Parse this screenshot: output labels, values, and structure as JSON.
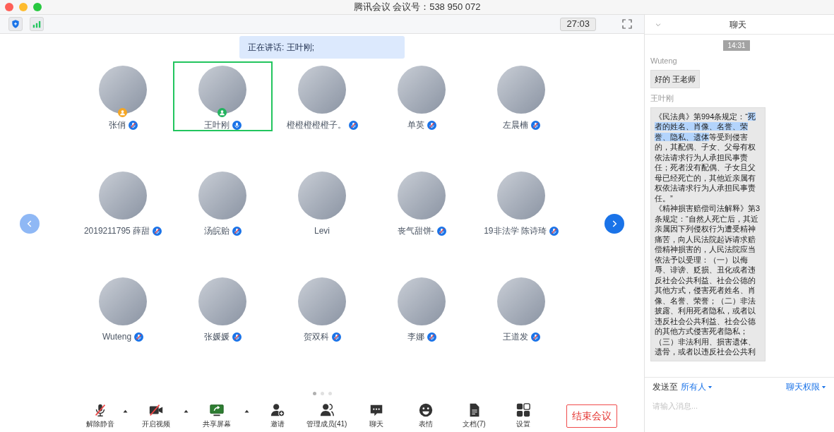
{
  "window": {
    "title": "腾讯会议 会议号：538 950 072"
  },
  "toolbar": {
    "timer": "27:03"
  },
  "speaking_banner": "正在讲话: 王叶刚;",
  "participants": [
    {
      "name": "张俏",
      "muted": true,
      "color": "#f5a623",
      "selected": false
    },
    {
      "name": "王叶刚",
      "muted": false,
      "color": "#22b35e",
      "selected": true
    },
    {
      "name": "橙橙橙橙橙子。",
      "muted": true,
      "selected": false
    },
    {
      "name": "单英",
      "muted": true,
      "selected": false
    },
    {
      "name": "左晨楠",
      "muted": true,
      "selected": false
    },
    {
      "name": "2019211795 薛甜",
      "muted": true,
      "selected": false
    },
    {
      "name": "汤皖贻",
      "muted": true,
      "selected": false
    },
    {
      "name": "Levi",
      "selected": false
    },
    {
      "name": "丧气甜饼-",
      "muted": true,
      "selected": false
    },
    {
      "name": "19非法学 陈诗琦",
      "muted": true,
      "selected": false
    },
    {
      "name": "Wuteng",
      "muted": true,
      "selected": false
    },
    {
      "name": "张媛媛",
      "muted": true,
      "selected": false
    },
    {
      "name": "贺双科",
      "muted": true,
      "selected": false
    },
    {
      "name": "李娜",
      "muted": true,
      "selected": false
    },
    {
      "name": "王道发",
      "muted": true,
      "selected": false
    }
  ],
  "pager": [
    {
      "selected": true
    },
    {
      "selected": false
    },
    {
      "selected": false
    }
  ],
  "bottom_bar": [
    {
      "kind": "mic",
      "label": "解除静音",
      "caret": true
    },
    {
      "kind": "video",
      "label": "开启视频",
      "caret": true
    },
    {
      "kind": "share",
      "label": "共享屏幕",
      "caret": true
    },
    {
      "kind": "invite",
      "label": "邀请",
      "caret": false
    },
    {
      "kind": "members",
      "label": "管理成员(41)",
      "caret": false
    },
    {
      "kind": "chat",
      "label": "聊天",
      "caret": false
    },
    {
      "kind": "emoji",
      "label": "表情",
      "caret": false
    },
    {
      "kind": "docs",
      "label": "文档(7)",
      "caret": false
    },
    {
      "kind": "settings",
      "label": "设置",
      "caret": false
    }
  ],
  "end_button": "结束会议",
  "chat": {
    "title": "聊天",
    "timestamp": "14:31",
    "messages": [
      {
        "sender": "Wuteng",
        "paragraphs": [
          [
            {
              "text": "好的 王老师",
              "highlighted": false
            }
          ]
        ]
      },
      {
        "sender": "王叶刚",
        "paragraphs": [
          [
            {
              "text": "《民法典》第994条规定：“",
              "highlighted": false
            },
            {
              "text": "死者的姓名、肖像、名誉、荣誉、隐私、遗体",
              "highlighted": true
            },
            {
              "text": "等受到侵害的，其配偶、子女、父母有权依法请求行为人承担民事责任；死者没有配偶、子女且父母已经死亡的，其他近亲属有权依法请求行为人承担民事责任。”",
              "highlighted": false
            }
          ],
          [
            {
              "text": "《精神损害赔偿司法解释》第3条规定：“自然人死亡后，其近亲属因下列侵权行为遭受精神痛苦，向人民法院起诉请求赔偿精神损害的，人民法院应当依法予以受理：（一）以侮辱、诽谤、贬损、丑化或者违反社会公共利益、社会公德的其他方式，侵害死者姓名、肖像、名誉、荣誉；（二）非法披露、利用死者隐私，或者以违反社会公共利益、社会公德的其他方式侵害死者隐私；",
              "highlighted": false
            }
          ],
          [
            {
              "text": "（三）非法利用、损害遗体、遗骨，或者以违反社会公共利",
              "highlighted": false
            }
          ]
        ]
      }
    ],
    "send_to_label": "发送至",
    "send_to_value": "所有人",
    "permissions": "聊天权限",
    "placeholder": "请输入消息..."
  }
}
